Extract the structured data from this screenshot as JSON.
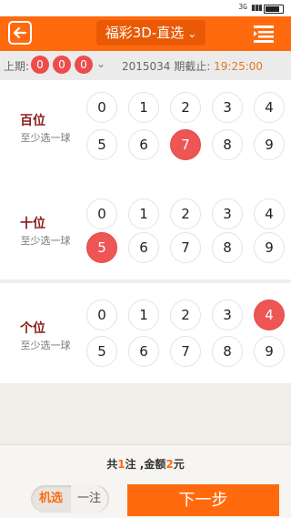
{
  "status": {
    "signal": "3G"
  },
  "header": {
    "title": "福彩3D-直选"
  },
  "last_draw": {
    "label": "上期:",
    "balls": [
      "0",
      "0",
      "0"
    ],
    "issue": "2015034 期截止:",
    "deadline": "19:25:00"
  },
  "sections": [
    {
      "name": "百位",
      "hint": "至少选一球",
      "numbers": [
        "0",
        "1",
        "2",
        "3",
        "4",
        "5",
        "6",
        "7",
        "8",
        "9"
      ],
      "selected": "7"
    },
    {
      "name": "十位",
      "hint": "至少选一球",
      "numbers": [
        "0",
        "1",
        "2",
        "3",
        "4",
        "5",
        "6",
        "7",
        "8",
        "9"
      ],
      "selected": "5"
    },
    {
      "name": "个位",
      "hint": "至少选一球",
      "numbers": [
        "0",
        "1",
        "2",
        "3",
        "4",
        "5",
        "6",
        "7",
        "8",
        "9"
      ],
      "selected": "4"
    }
  ],
  "summary": {
    "prefix": "共",
    "count": "1",
    "mid": "注 ,金额",
    "amount": "2",
    "suffix": "元"
  },
  "footer": {
    "random_label": "机选",
    "single_label": "一注",
    "next_label": "下一步"
  },
  "colors": {
    "accent": "#ff6a0e",
    "selected_ball": "#ee5555",
    "position_name": "#8b1a1a"
  }
}
